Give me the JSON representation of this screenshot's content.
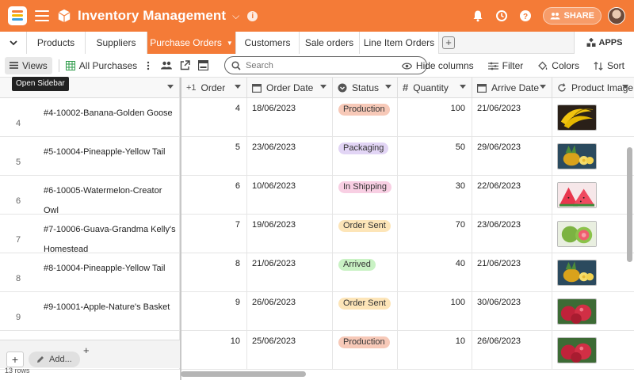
{
  "header": {
    "app_title": "Inventory Management",
    "share_label": "SHARE",
    "colors": {
      "bar": "#f47b37"
    },
    "icons": [
      "hamburger-icon",
      "cube-icon",
      "chevron-down-icon",
      "info-icon",
      "bell-icon",
      "history-icon",
      "help-icon",
      "share-icon"
    ]
  },
  "tabs": [
    {
      "label": "Products",
      "active": false
    },
    {
      "label": "Suppliers",
      "active": false
    },
    {
      "label": "Purchase Orders",
      "active": true
    },
    {
      "label": "Customers",
      "active": false
    },
    {
      "label": "Sale orders",
      "active": false
    },
    {
      "label": "Line Item Orders",
      "active": false
    }
  ],
  "apps_label": "APPS",
  "toolbar": {
    "views_label": "Views",
    "view_name": "All Purchases",
    "search_placeholder": "Search",
    "hide_columns": "Hide columns",
    "filter": "Filter",
    "colors": "Colors",
    "sort": "Sort",
    "tooltip": "Open Sidebar"
  },
  "columns": {
    "order": "Order",
    "order_date": "Order Date",
    "status": "Status",
    "quantity": "Quantity",
    "arrive_date": "Arrive Date",
    "product_image": "Product Image"
  },
  "rows": [
    {
      "num": "4",
      "name": "#4-10002-Banana-Golden Goose",
      "order": "4",
      "order_date": "18/06/2023",
      "status": "Production",
      "quantity": "100",
      "arrive_date": "21/06/2023",
      "fruit": "banana"
    },
    {
      "num": "5",
      "name": "#5-10004-Pineapple-Yellow Tail",
      "order": "5",
      "order_date": "23/06/2023",
      "status": "Packaging",
      "quantity": "50",
      "arrive_date": "29/06/2023",
      "fruit": "pineapple"
    },
    {
      "num": "6",
      "name": "#6-10005-Watermelon-Creator Owl",
      "order": "6",
      "order_date": "10/06/2023",
      "status": "In Shipping",
      "quantity": "30",
      "arrive_date": "22/06/2023",
      "fruit": "watermelon"
    },
    {
      "num": "7",
      "name": "#7-10006-Guava-Grandma Kelly's Homestead",
      "order": "7",
      "order_date": "19/06/2023",
      "status": "Order Sent",
      "quantity": "70",
      "arrive_date": "23/06/2023",
      "fruit": "guava"
    },
    {
      "num": "8",
      "name": "#8-10004-Pineapple-Yellow Tail",
      "order": "8",
      "order_date": "21/06/2023",
      "status": "Arrived",
      "quantity": "40",
      "arrive_date": "21/06/2023",
      "fruit": "pineapple"
    },
    {
      "num": "9",
      "name": "#9-10001-Apple-Nature's Basket",
      "order": "9",
      "order_date": "26/06/2023",
      "status": "Order Sent",
      "quantity": "100",
      "arrive_date": "30/06/2023",
      "fruit": "apple"
    },
    {
      "num": "",
      "name": "",
      "order": "10",
      "order_date": "25/06/2023",
      "status": "Production",
      "quantity": "10",
      "arrive_date": "26/06/2023",
      "fruit": "apple"
    }
  ],
  "status_colors": {
    "Production": {
      "bg": "#f7c9b8",
      "fg": "#333333"
    },
    "Packaging": {
      "bg": "#e2d5f5",
      "fg": "#333333"
    },
    "In Shipping": {
      "bg": "#f8cfe3",
      "fg": "#333333"
    },
    "Order Sent": {
      "bg": "#fde5b8",
      "fg": "#333333"
    },
    "Arrived": {
      "bg": "#c9f2c4",
      "fg": "#333333"
    }
  },
  "footer": {
    "add_label": "Add...",
    "rows_count": "13 rows"
  }
}
